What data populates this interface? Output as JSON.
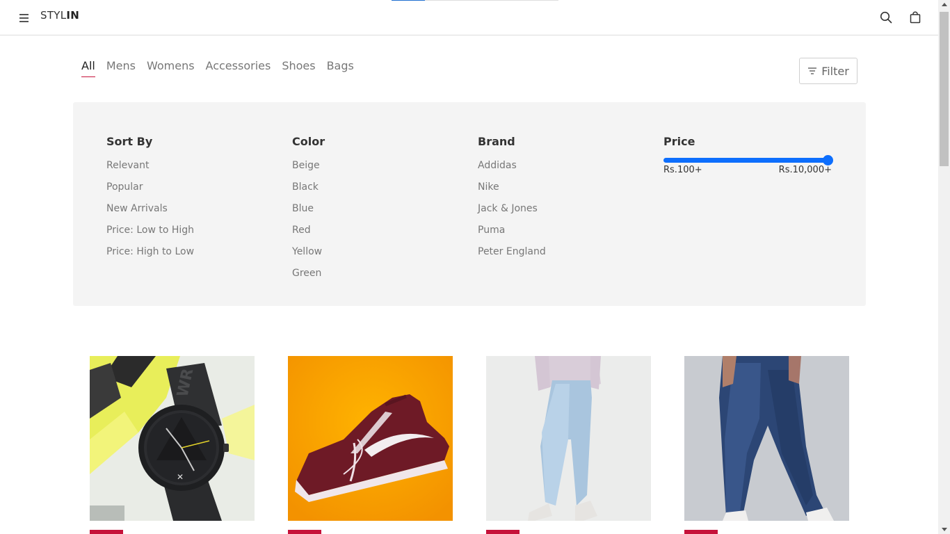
{
  "header": {
    "logo_prefix": "STYL",
    "logo_suffix": "IN",
    "loading_progress": 0.2
  },
  "tabs": [
    {
      "label": "All",
      "active": true
    },
    {
      "label": "Mens"
    },
    {
      "label": "Womens"
    },
    {
      "label": "Accessories"
    },
    {
      "label": "Shoes"
    },
    {
      "label": "Bags"
    }
  ],
  "filter_button": {
    "label": "Filter",
    "icon": "filter-icon"
  },
  "filters": {
    "sort_by": {
      "title": "Sort By",
      "options": [
        "Relevant",
        "Popular",
        "New Arrivals",
        "Price: Low to High",
        "Price: High to Low"
      ]
    },
    "color": {
      "title": "Color",
      "options": [
        "Beige",
        "Black",
        "Blue",
        "Red",
        "Yellow",
        "Green"
      ]
    },
    "brand": {
      "title": "Brand",
      "options": [
        "Addidas",
        "Nike",
        "Jack & Jones",
        "Puma",
        "Peter England"
      ]
    },
    "price": {
      "title": "Price",
      "min_label": "Rs.100+",
      "max_label": "Rs.10,000+",
      "selected_fraction": 1.0
    }
  },
  "products": [
    {
      "kind": "watch"
    },
    {
      "kind": "sneaker"
    },
    {
      "kind": "light-jeans"
    },
    {
      "kind": "dark-jeans"
    }
  ],
  "colors": {
    "accent": "#c6123a",
    "slider": "#0d6efd",
    "panel_bg": "#f4f4f4"
  }
}
